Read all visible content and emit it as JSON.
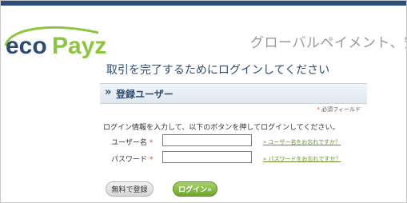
{
  "brand": {
    "logo_text_eco": "eco",
    "logo_text_payz": "Payz",
    "colors": {
      "eco": "#2c4a74",
      "payz": "#8cc63f",
      "accent": "#2d4b73"
    }
  },
  "header": {
    "tagline": "グローバルペイメント、安"
  },
  "main": {
    "headline": "取引を完了するためにログインしてください"
  },
  "card": {
    "title_chevron": "»",
    "title": "登録ユーザー",
    "required_star": "*",
    "required_note": "必須フィールド",
    "instructions": "ログイン情報を入力して、以下のボタンを押してログインしてください。",
    "username": {
      "label": "ユーザー名",
      "star": "*",
      "value": "",
      "forgot_arrow": "»",
      "forgot_link": "ユーザー名をお忘れですか？"
    },
    "password": {
      "label": "パスワード",
      "star": "*",
      "value": "",
      "forgot_arrow": "»",
      "forgot_link": "パスワードをお忘れですか？"
    }
  },
  "buttons": {
    "register": "無料で登録",
    "login": "ログイン»"
  }
}
